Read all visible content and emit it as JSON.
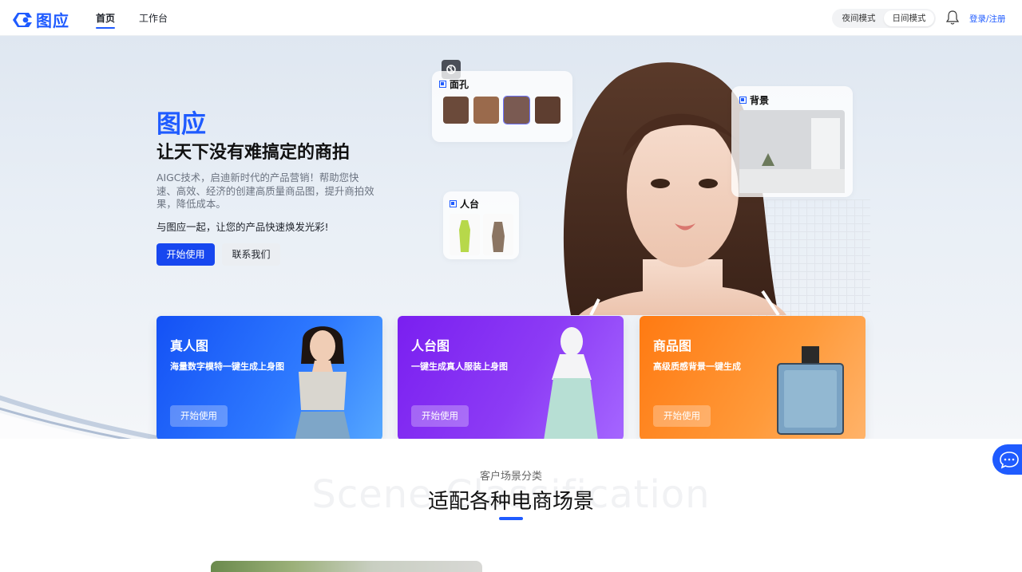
{
  "nav": {
    "logo_text": "图应",
    "links": [
      {
        "label": "首页",
        "active": true
      },
      {
        "label": "工作台",
        "active": false
      }
    ],
    "mode": {
      "night": "夜间模式",
      "day": "日间模式",
      "selected": "日间模式"
    },
    "bell_icon": "bell-icon",
    "login": "登录/注册"
  },
  "hero": {
    "title": "图应",
    "subtitle": "让天下没有难搞定的商拍",
    "description": "AIGC技术，启迪新时代的产品营销！帮助您快速、高效、经济的创建高质量商品图，提升商拍效果，降低成本。",
    "slogan": "与图应一起，让您的产品快速焕发光彩!",
    "primary_button": "开始使用",
    "secondary_button": "联系我们",
    "tags": {
      "face": "面孔",
      "background": "背景",
      "mannequin": "人台"
    }
  },
  "cards": [
    {
      "title": "真人图",
      "desc": "海量数字模特一键生成上身图",
      "button": "开始使用"
    },
    {
      "title": "人台图",
      "desc": "一键生成真人服装上身图",
      "button": "开始使用"
    },
    {
      "title": "商品图",
      "desc": "高级质感背景一键生成",
      "button": "开始使用"
    }
  ],
  "section": {
    "subtitle": "客户场景分类",
    "background_text": "Scene Classification",
    "title": "适配各种电商场景"
  },
  "colors": {
    "brand": "#1f5bff",
    "card_blue": "#1f5bff",
    "card_purple": "#8a2bf2",
    "card_orange": "#ff8a1d"
  }
}
